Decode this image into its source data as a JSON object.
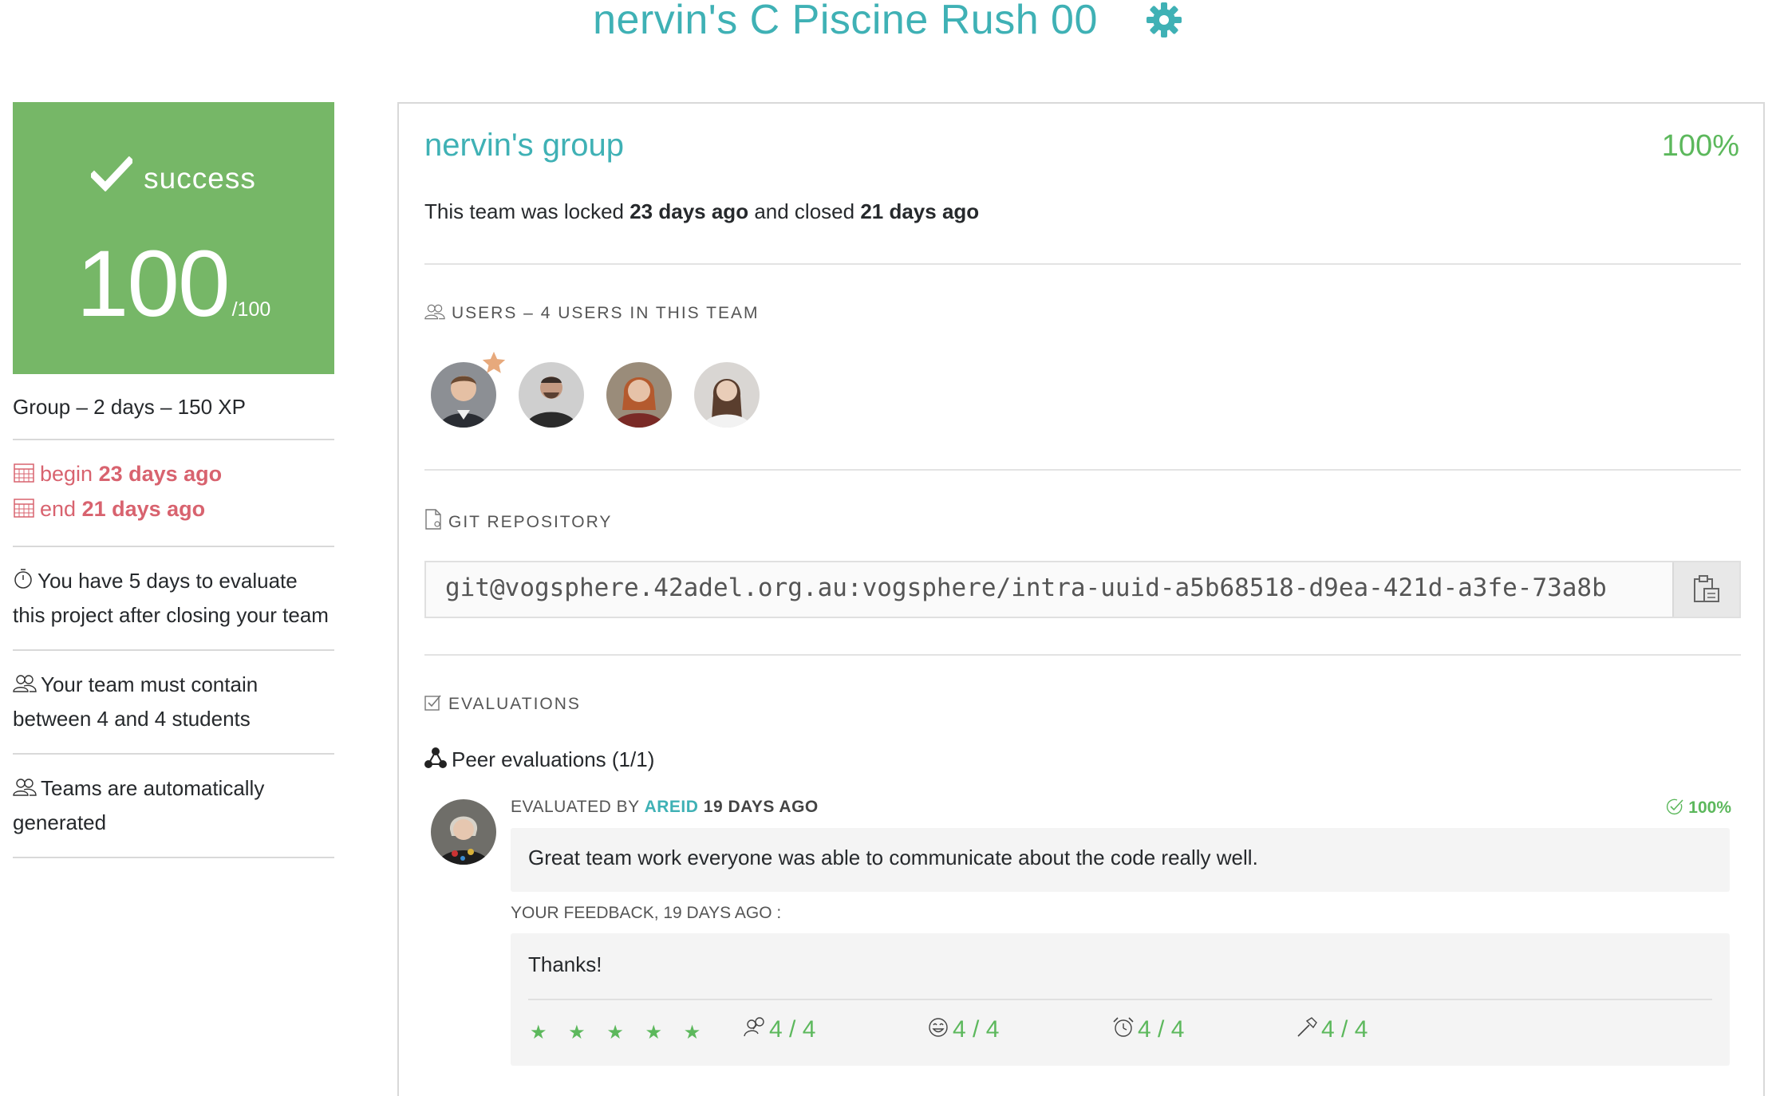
{
  "header": {
    "title": "nervin's C Piscine Rush 00",
    "settings_icon": "gear-icon"
  },
  "status": {
    "label": "success",
    "score": "100",
    "max": "/100"
  },
  "left": {
    "meta": "Group – 2 days – 150 XP",
    "begin_label": "begin",
    "begin_value": "23 days ago",
    "end_label": "end",
    "end_value": "21 days ago",
    "evaluate_note": "You have 5 days to evaluate this project after closing your team",
    "team_size_note": "Your team must contain between 4 and 4 students",
    "team_gen_note": "Teams are automatically generated"
  },
  "group": {
    "name": "nervin's group",
    "percent": "100%",
    "locked_prefix": "This team was locked",
    "locked_value": "23 days ago",
    "closed_prefix": "and closed",
    "closed_value": "21 days ago"
  },
  "users": {
    "label": "USERS – 4 USERS IN THIS TEAM",
    "members": [
      "member-1",
      "member-2",
      "member-3",
      "member-4"
    ]
  },
  "git": {
    "label": "GIT REPOSITORY",
    "url": "git@vogsphere.42adel.org.au:vogsphere/intra-uuid-a5b68518-d9ea-421d-a3fe-73a8b"
  },
  "evaluations": {
    "label": "EVALUATIONS",
    "peer_title": "Peer evaluations (1/1)",
    "evaluated_by_prefix": "EVALUATED BY",
    "evaluator": "AREID",
    "when": "19 DAYS AGO",
    "percent": "100%",
    "comment": "Great team work everyone was able to communicate about the code really well.",
    "feedback_head": "YOUR FEEDBACK, 19 DAYS AGO :",
    "feedback": "Thanks!",
    "stars": "★ ★ ★ ★ ★",
    "ratings": [
      "4 / 4",
      "4 / 4",
      "4 / 4",
      "4 / 4"
    ]
  },
  "colors": {
    "accent": "#3fb1b5",
    "success": "#76b767",
    "danger": "#d8636f",
    "positive": "#5cb85c"
  }
}
